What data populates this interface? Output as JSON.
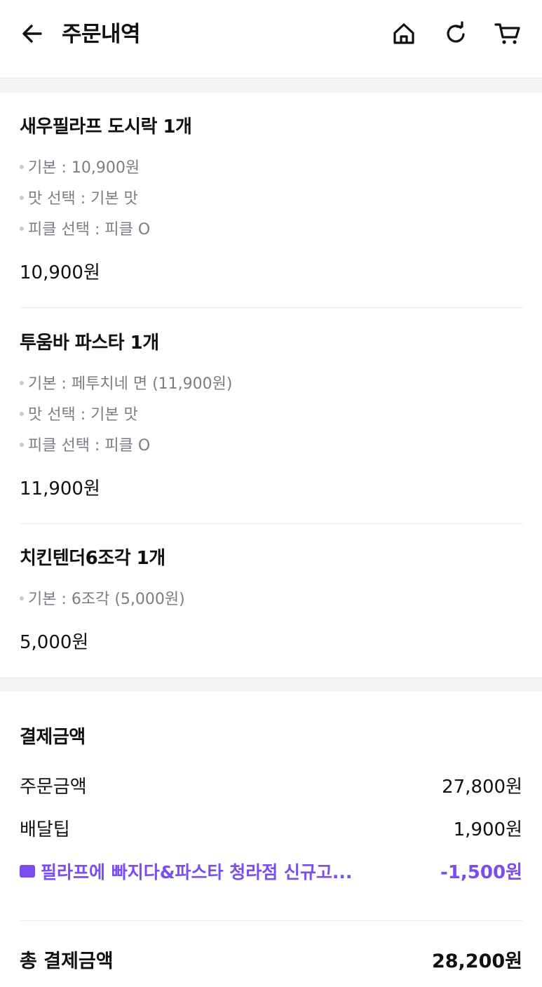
{
  "header": {
    "title": "주문내역",
    "icons": [
      "back-arrow-icon",
      "home-icon",
      "refresh-icon",
      "cart-icon"
    ]
  },
  "items": [
    {
      "name": "새우필라프 도시락 1개",
      "options": [
        "기본 : 10,900원",
        "맛 선택 : 기본 맛",
        "피클 선택 : 피클 O"
      ],
      "price": "10,900원"
    },
    {
      "name": "투움바 파스타 1개",
      "options": [
        "기본 : 페투치네 면 (11,900원)",
        "맛 선택 : 기본 맛",
        "피클 선택 : 피클 O"
      ],
      "price": "11,900원"
    },
    {
      "name": "치킨텐더6조각 1개",
      "options": [
        "기본 : 6조각 (5,000원)"
      ],
      "price": "5,000원"
    }
  ],
  "payment": {
    "title": "결제금액",
    "order_amount_label": "주문금액",
    "order_amount": "27,800원",
    "delivery_tip_label": "배달팁",
    "delivery_tip": "1,900원",
    "coupon_label": "필라프에 빠지다&파스타 청라점 신규고...",
    "coupon_amount": "-1,500원",
    "total_label": "총 결제금액",
    "total_amount": "28,200원"
  },
  "colors": {
    "accent": "#7a4df0",
    "muted_text": "#7b7d84",
    "section_gap": "#f2f3f5"
  }
}
